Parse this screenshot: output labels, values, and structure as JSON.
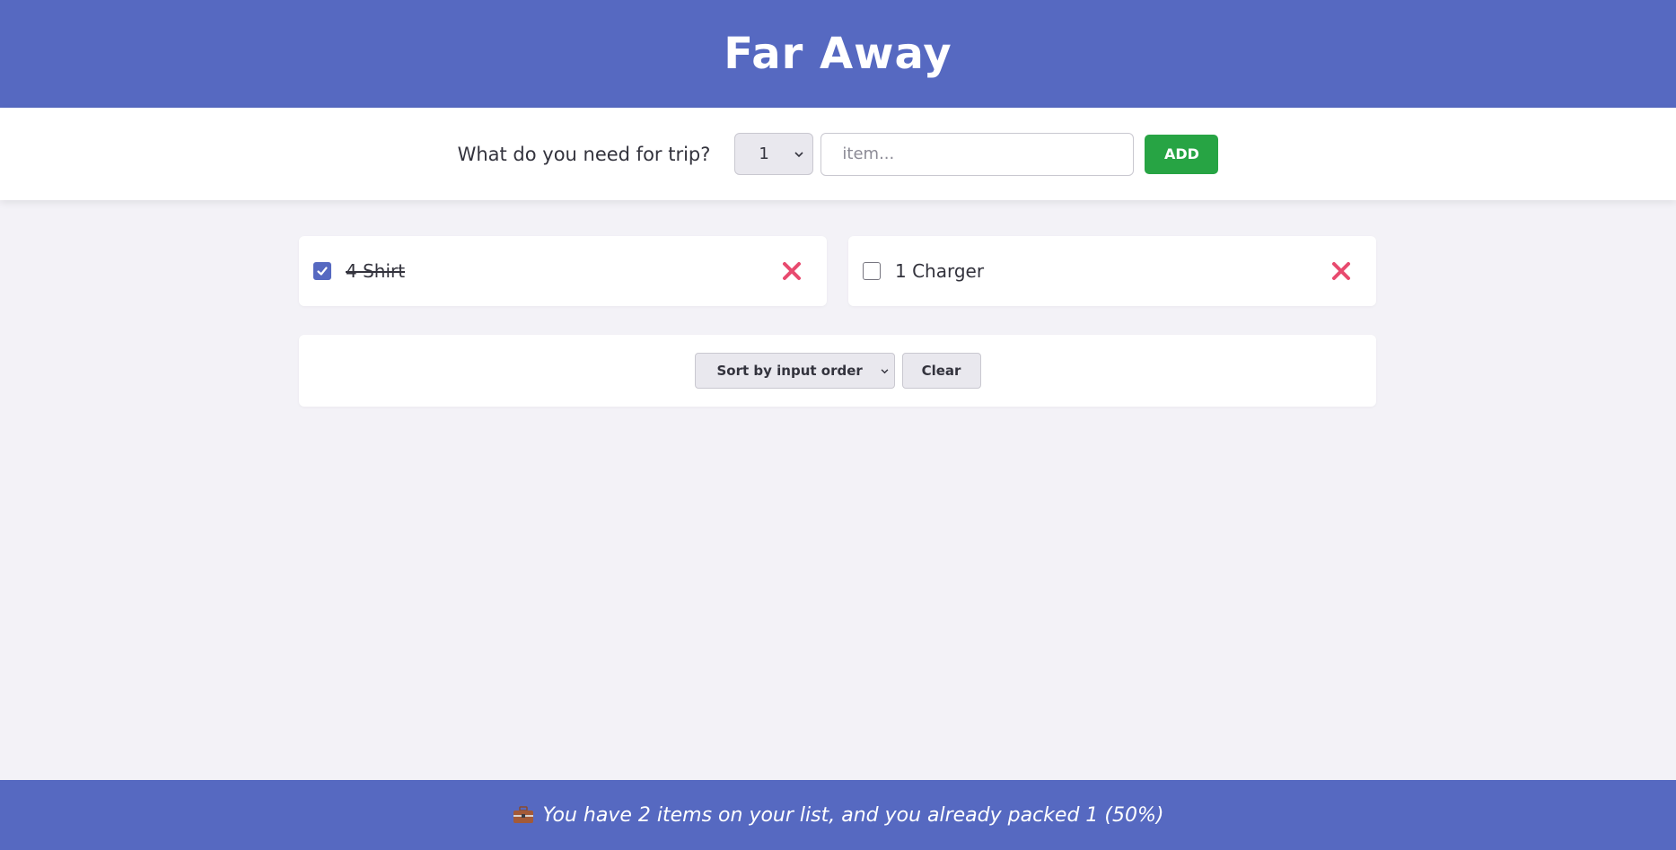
{
  "app": {
    "title": "Far Away"
  },
  "form": {
    "prompt": "What do you need for trip?",
    "quantity_selected": "1",
    "item_placeholder": "item...",
    "add_label": "ADD"
  },
  "items": [
    {
      "quantity": 4,
      "description": "Shirt",
      "label": "4 Shirt",
      "packed": true
    },
    {
      "quantity": 1,
      "description": "Charger",
      "label": "1 Charger",
      "packed": false
    }
  ],
  "actions": {
    "sort_selected": "Sort by input order",
    "clear_label": "Clear"
  },
  "stats": {
    "text": "You have 2 items on your list, and you already packed 1 (50%)",
    "total_items": 2,
    "packed_items": 1,
    "packed_percent": 50
  },
  "colors": {
    "primary": "#5669c1",
    "add_button": "#27a444",
    "delete_icon": "#e84a6f",
    "background": "#f3f2f7"
  },
  "icons": {
    "delete": "close-icon",
    "checkbox": "checkmark-icon",
    "footer": "suitcase-icon",
    "select": "chevron-down-icon"
  }
}
